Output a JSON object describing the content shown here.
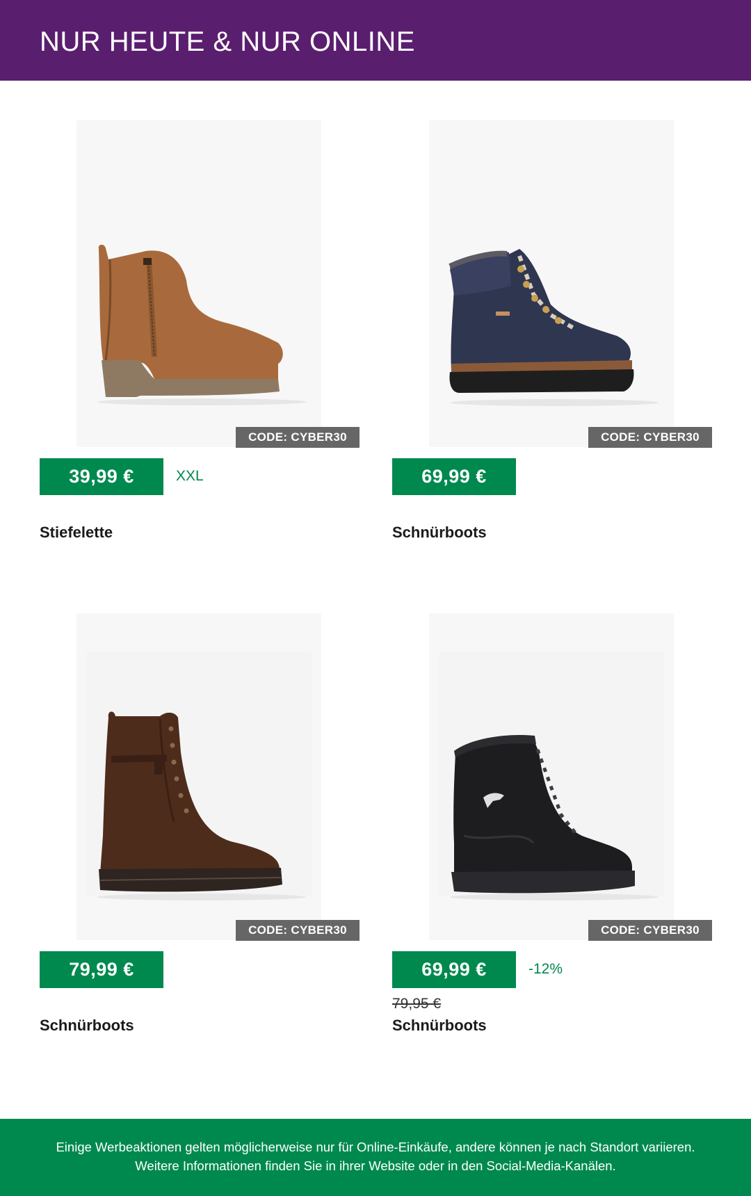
{
  "header": {
    "title": "NUR HEUTE & NUR ONLINE"
  },
  "products": [
    {
      "name": "Stiefelette",
      "price": "39,99 €",
      "code": "CODE: CYBER30",
      "extra": "XXL",
      "old_price": "",
      "image": "brown-ankle-boot"
    },
    {
      "name": "Schnürboots",
      "price": "69,99 €",
      "code": "CODE: CYBER30",
      "extra": "",
      "old_price": "",
      "image": "navy-hiking-boot"
    },
    {
      "name": "Schnürboots",
      "price": "79,99 €",
      "code": "CODE: CYBER30",
      "extra": "",
      "old_price": "",
      "image": "dark-brown-lace-boot"
    },
    {
      "name": "Schnürboots",
      "price": "69,99 €",
      "code": "CODE: CYBER30",
      "extra": "-12%",
      "old_price": "79,95 €",
      "image": "black-winter-boot"
    }
  ],
  "footer": {
    "text": "Einige Werbeaktionen gelten möglicherweise nur für Online-Einkäufe, andere können je nach Standort variieren. Weitere Informationen finden Sie in ihrer Website oder in den Social-Media-Kanälen."
  },
  "colors": {
    "header_bg": "#5a1e6e",
    "price_bg": "#00894e",
    "code_bg": "#666666",
    "footer_bg": "#00894e"
  }
}
